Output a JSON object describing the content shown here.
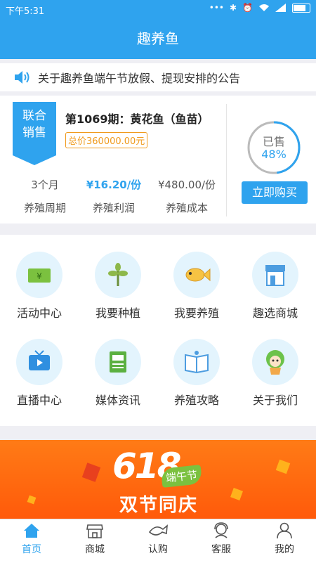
{
  "status": {
    "time": "下午5:31"
  },
  "header": {
    "title": "趣养鱼"
  },
  "notice": {
    "text": "关于趣养鱼端午节放假、提现安排的公告"
  },
  "product": {
    "ribbon_line1": "联合",
    "ribbon_line2": "销售",
    "title": "第1069期：黄花鱼（鱼苗）",
    "total_price": "总价360000.00元",
    "stats": [
      {
        "value": "3个月",
        "label": "养殖周期"
      },
      {
        "value": "¥16.20/份",
        "label": "养殖利润"
      },
      {
        "value": "¥480.00/份",
        "label": "养殖成本"
      }
    ],
    "sold_label": "已售",
    "sold_percent_text": "48%",
    "sold_fraction": 0.48,
    "buy_label": "立即购买"
  },
  "menu": [
    {
      "label": "活动中心",
      "icon": "ticket-icon"
    },
    {
      "label": "我要种植",
      "icon": "plant-icon"
    },
    {
      "label": "我要养殖",
      "icon": "fish-icon"
    },
    {
      "label": "趣选商城",
      "icon": "shop-icon"
    },
    {
      "label": "直播中心",
      "icon": "tv-icon"
    },
    {
      "label": "媒体资讯",
      "icon": "news-icon"
    },
    {
      "label": "养殖攻略",
      "icon": "book-icon"
    },
    {
      "label": "关于我们",
      "icon": "mascot-icon"
    }
  ],
  "banner": {
    "big": "618",
    "badge": "端午节",
    "slogan": "双节同庆"
  },
  "tabs": [
    {
      "label": "首页",
      "icon": "home-icon",
      "active": true
    },
    {
      "label": "商城",
      "icon": "store-icon"
    },
    {
      "label": "认购",
      "icon": "fish-outline-icon"
    },
    {
      "label": "客服",
      "icon": "service-icon"
    },
    {
      "label": "我的",
      "icon": "user-icon"
    }
  ],
  "colors": {
    "primary": "#2fa3ee",
    "price_tag": "#f09a1c",
    "banner": "#ff6a10"
  }
}
